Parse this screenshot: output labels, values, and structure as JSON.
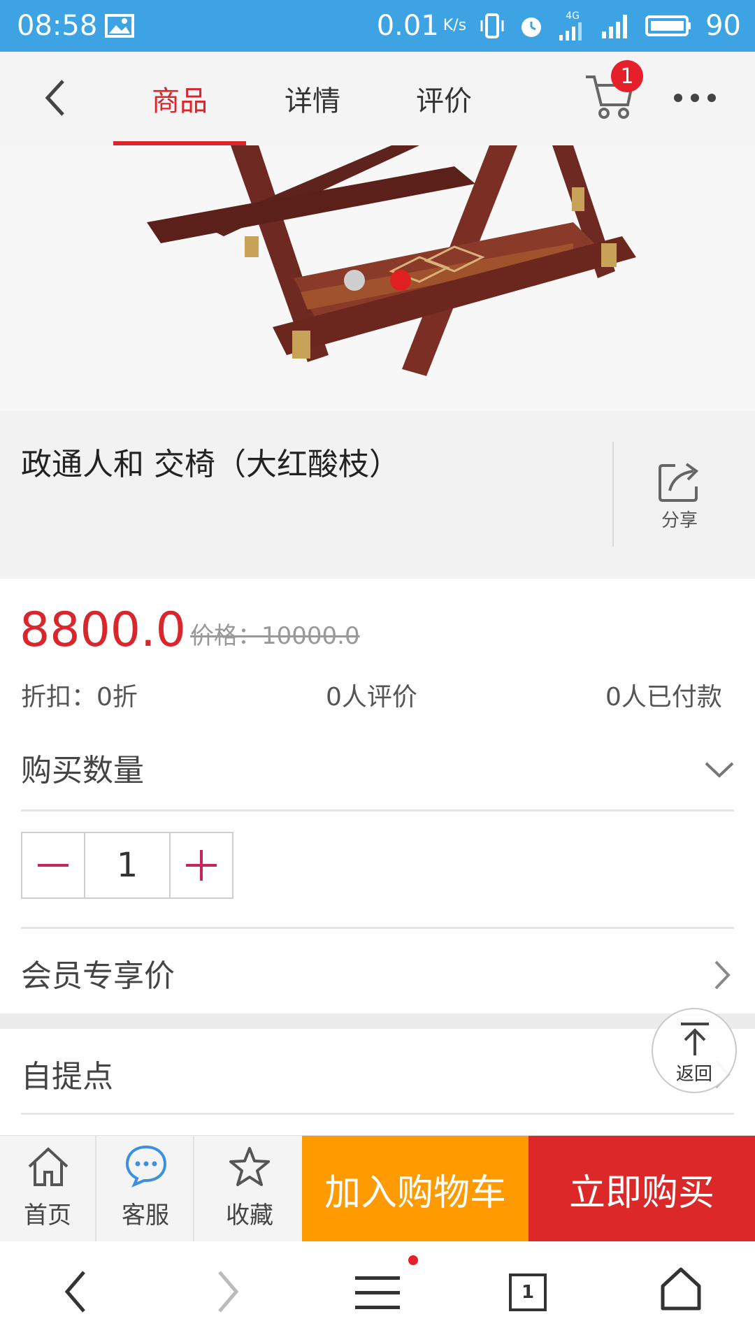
{
  "status_bar": {
    "time": "08:58",
    "network_speed": "0.01",
    "network_unit": "K/s",
    "network_type": "4G",
    "battery": "90"
  },
  "top_nav": {
    "tabs": [
      {
        "label": "商品",
        "active": true
      },
      {
        "label": "详情",
        "active": false
      },
      {
        "label": "评价",
        "active": false
      }
    ],
    "cart_count": "1"
  },
  "gallery": {
    "slide_count": 2,
    "active_slide": 2
  },
  "product": {
    "title": "政通人和 交椅（大红酸枝）",
    "share_label": "分享",
    "price": "8800.0",
    "original_price": "价格：10000.0",
    "discount": "折扣：0折",
    "reviews": "0人评价",
    "paid": "0人已付款"
  },
  "purchase": {
    "quantity_label": "购买数量",
    "quantity": "1",
    "member_price_label": "会员专享价",
    "pickup_label": "自提点"
  },
  "back_to_top_label": "返回",
  "action_bar": {
    "home": "首页",
    "service": "客服",
    "favorite": "收藏",
    "add_to_cart": "加入购物车",
    "buy_now": "立即购买"
  },
  "browser": {
    "tab_count": "1"
  },
  "colors": {
    "status_bar": "#3da3e3",
    "accent_red": "#d8262c",
    "cart_orange": "#ff9a00",
    "buy_red": "#dc2828"
  }
}
